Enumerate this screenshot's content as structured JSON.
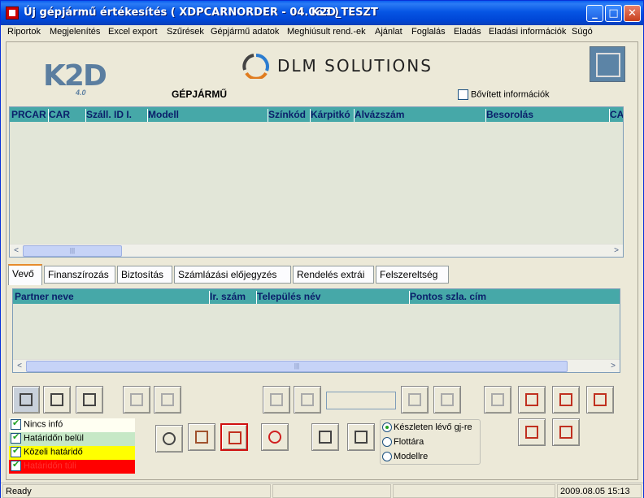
{
  "window": {
    "title": "Új gépjármű értékesítés ( XDPCARNORDER - 04.065 )",
    "title_env": "K2D_TESZT",
    "min_glyph": "_",
    "max_glyph": "□",
    "close_glyph": "✕"
  },
  "menu": [
    "Riportok",
    "Megjelenítés",
    "Excel export",
    "Szűrések",
    "Gépjármű adatok",
    "Meghiúsult rend.-ek",
    "Ajánlat",
    "Foglalás",
    "Eladás",
    "Eladási információk",
    "Súgó"
  ],
  "logos": {
    "k2d": "K2D",
    "k2d_version": "4.0",
    "dlm": "DLM SOLUTIONS"
  },
  "page_title": "GÉPJÁRMŰ",
  "bovitett_label": "Bővített információk",
  "top_grid": {
    "columns": [
      "PRCAR",
      "CAR",
      "Száll. ID I.",
      "Modell",
      "Színkód",
      "Kárpitkó",
      "Alvázszám",
      "Besorolás",
      "CA"
    ]
  },
  "tabs": [
    "Vevő",
    "Finanszírozás",
    "Biztosítás",
    "Számlázási előjegyzés",
    "Rendelés extrái",
    "Felszereltség"
  ],
  "bottom_grid": {
    "columns": [
      "Partner neve",
      "Ir. szám",
      "Település név",
      "Pontos szla. cím"
    ]
  },
  "legend": [
    {
      "label": "Nincs infó",
      "bg": "#fffff2",
      "color": "#000"
    },
    {
      "label": "Határidőn belül",
      "bg": "#c6e8c6",
      "color": "#000"
    },
    {
      "label": "Közeli határidő",
      "bg": "#ffff00",
      "color": "#000"
    },
    {
      "label": "Határidőn túli",
      "bg": "#ff0000",
      "color": "#ff0000"
    }
  ],
  "radio_options": [
    "Készleten lévő gj-re",
    "Flottára",
    "Modellre"
  ],
  "scroll": {
    "left": "<",
    "right": ">",
    "grip": "|||"
  },
  "status": {
    "text": "Ready",
    "datetime": "2009.08.05 15:13"
  }
}
